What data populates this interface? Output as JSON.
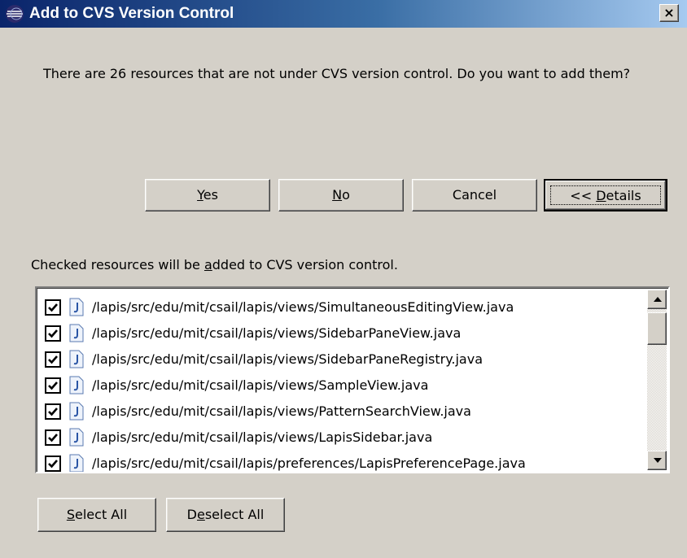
{
  "window": {
    "title": "Add to CVS Version Control",
    "close_label": "×"
  },
  "message": "There are 26 resources that are not under CVS version control. Do you want to add them?",
  "buttons": {
    "yes": {
      "pre": "",
      "key": "Y",
      "post": "es"
    },
    "no": {
      "pre": "",
      "key": "N",
      "post": "o"
    },
    "cancel": {
      "label": "Cancel"
    },
    "details": {
      "pre": "<< ",
      "key": "D",
      "post": "etails"
    }
  },
  "resources_label": {
    "pre": "Checked resources will be ",
    "key": "a",
    "post": "dded to CVS version control."
  },
  "resources": [
    {
      "path": "/lapis/src/edu/mit/csail/lapis/views/SimultaneousEditingView.java",
      "checked": true
    },
    {
      "path": "/lapis/src/edu/mit/csail/lapis/views/SidebarPaneView.java",
      "checked": true
    },
    {
      "path": "/lapis/src/edu/mit/csail/lapis/views/SidebarPaneRegistry.java",
      "checked": true
    },
    {
      "path": "/lapis/src/edu/mit/csail/lapis/views/SampleView.java",
      "checked": true
    },
    {
      "path": "/lapis/src/edu/mit/csail/lapis/views/PatternSearchView.java",
      "checked": true
    },
    {
      "path": "/lapis/src/edu/mit/csail/lapis/views/LapisSidebar.java",
      "checked": true
    },
    {
      "path": "/lapis/src/edu/mit/csail/lapis/preferences/LapisPreferencePage.java",
      "checked": true
    }
  ],
  "bottom_buttons": {
    "select_all": {
      "pre": "",
      "key": "S",
      "post": "elect All"
    },
    "deselect_all": {
      "pre": "D",
      "key": "e",
      "post": "select All"
    }
  },
  "icons": {
    "app": "eclipse-icon",
    "close": "close-icon",
    "file": "java-file-icon",
    "check": "checkmark-icon",
    "up": "arrow-up-icon",
    "down": "arrow-down-icon"
  },
  "colors": {
    "dialog_bg": "#d4d0c8",
    "title_start": "#0a246a",
    "title_end": "#a6caf0",
    "list_bg": "#ffffff"
  }
}
